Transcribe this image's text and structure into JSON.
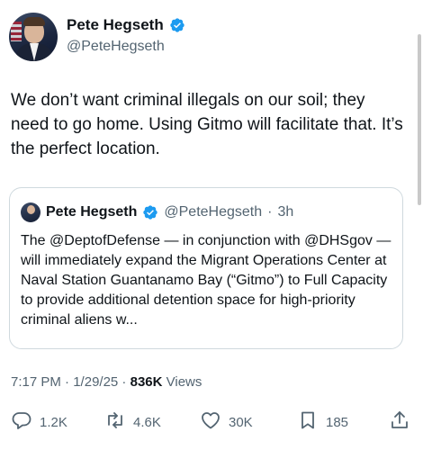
{
  "author": {
    "name": "Pete Hegseth",
    "handle": "@PeteHegseth"
  },
  "tweet": {
    "text": "We don’t want criminal illegals on our soil; they need to go home. Using Gitmo will facilitate that. It’s the perfect location."
  },
  "quote": {
    "name": "Pete Hegseth",
    "handle": "@PeteHegseth",
    "separator": "·",
    "age": "3h",
    "text": "The @DeptofDefense — in conjunction with @DHSgov — will immediately expand the Migrant Operations Center at Naval Station Guantanamo Bay (“Gitmo”) to Full Capacity to provide additional detention space for high-priority criminal aliens w..."
  },
  "meta": {
    "time": "7:17 PM",
    "sep1": " · ",
    "date": "1/29/25",
    "sep2": " · ",
    "views_count": "836K",
    "views_label": " Views"
  },
  "actions": {
    "replies": "1.2K",
    "reposts": "4.6K",
    "likes": "30K",
    "bookmarks": "185"
  },
  "colors": {
    "verified": "#1d9bf0",
    "secondary_text": "#536471",
    "border": "#cfd9de"
  },
  "icons": {
    "verified": "verified-badge-icon",
    "reply": "reply-icon",
    "repost": "repost-icon",
    "like": "heart-icon",
    "bookmark": "bookmark-icon",
    "share": "share-icon"
  }
}
